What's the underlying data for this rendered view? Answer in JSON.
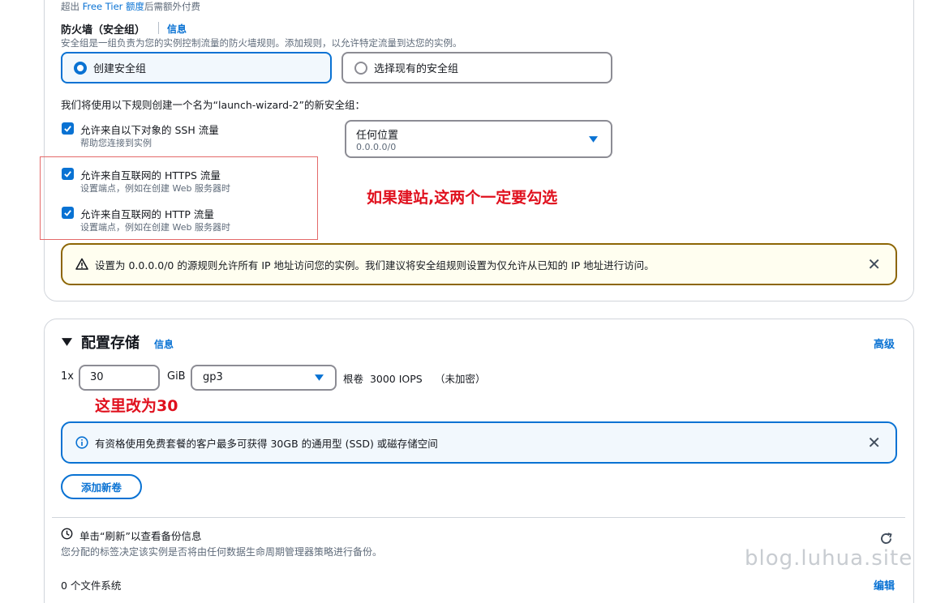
{
  "network": {
    "free_tier_prefix": "超出 ",
    "free_tier_link": "Free Tier",
    "free_tier_link2": " 额度",
    "free_tier_suffix": "后需额外付费",
    "firewall_title": "防火墙（安全组）",
    "info_link": "信息",
    "firewall_desc": "安全组是一组负责为您的实例控制流量的防火墙规则。添加规则，以允许特定流量到达您的实例。",
    "create_sg_label": "创建安全组",
    "select_sg_label": "选择现有的安全组",
    "rules_intro": "我们将使用以下规则创建一个名为“launch-wizard-2”的新安全组：",
    "rules": [
      {
        "label": "允许来自以下对象的 SSH 流量",
        "desc": "帮助您连接到实例",
        "checked": true
      },
      {
        "label": "允许来自互联网的 HTTPS 流量",
        "desc": "设置端点，例如在创建 Web 服务器时",
        "checked": true
      },
      {
        "label": "允许来自互联网的 HTTP 流量",
        "desc": "设置端点，例如在创建 Web 服务器时",
        "checked": true
      }
    ],
    "ssh_source_value": "任何位置",
    "ssh_source_cidr": "0.0.0.0/0",
    "annotation_web": "如果建站,这两个一定要勾选",
    "warning_text": "设置为 0.0.0.0/0 的源规则允许所有 IP 地址访问您的实例。我们建议将安全组规则设置为仅允许从已知的 IP 地址进行访问。"
  },
  "storage": {
    "title": "配置存储",
    "info_link": "信息",
    "advanced_link": "高级",
    "count_prefix": "1x",
    "size_value": "30",
    "unit": "GiB",
    "volume_type": "gp3",
    "root_volume_text": "根卷  3000 IOPS",
    "encryption_text": "（未加密）",
    "annotation_size": "这里改为30",
    "info_alert_text": "有资格使用免费套餐的客户最多可获得 30GB 的通用型 (SSD) 或磁存储空间",
    "add_volume_label": "添加新卷",
    "backup_title": "单击“刷新”以查看备份信息",
    "backup_desc": "您分配的标签决定该实例是否将由任何数据生命周期管理器策略进行备份。",
    "file_systems_text": "0 个文件系统",
    "edit_link": "编辑"
  },
  "watermark": "blog.luhua.site",
  "colors": {
    "accent": "#0972d3",
    "selected_bg": "#f2f8fd",
    "warning_border": "#8d6605",
    "warning_bg": "#fffef0",
    "info_border": "#0972d3",
    "info_bg": "#f2f8fd",
    "annotation_red": "#e0111e"
  }
}
